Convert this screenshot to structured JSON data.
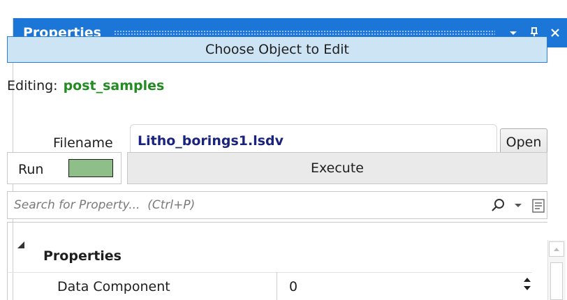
{
  "panel": {
    "title": "Properties",
    "accent_color": "#1c76d8",
    "title_buttons": [
      {
        "icon": "chevron-down-icon",
        "glyph": "▾"
      },
      {
        "icon": "pin-icon",
        "glyph": "ᴘ"
      },
      {
        "icon": "close-icon",
        "glyph": "✕"
      }
    ]
  },
  "choose_object": {
    "label": "Choose Object to Edit"
  },
  "editing": {
    "label": "Editing:",
    "value": "post_samples",
    "value_color": "#228b22"
  },
  "filename": {
    "label": "Filename",
    "value": "Litho_borings1.lsdv",
    "open_label": "Open"
  },
  "run": {
    "label": "Run",
    "swatch_color": "#8fbf88",
    "execute_label": "Execute"
  },
  "search": {
    "placeholder": "Search for Property...  (Ctrl+P)",
    "icon": "search-icon"
  },
  "property_grid": {
    "category": {
      "label": "Properties",
      "expanded": true
    },
    "rows": [
      {
        "name": "Data Component",
        "value": "0"
      }
    ]
  }
}
